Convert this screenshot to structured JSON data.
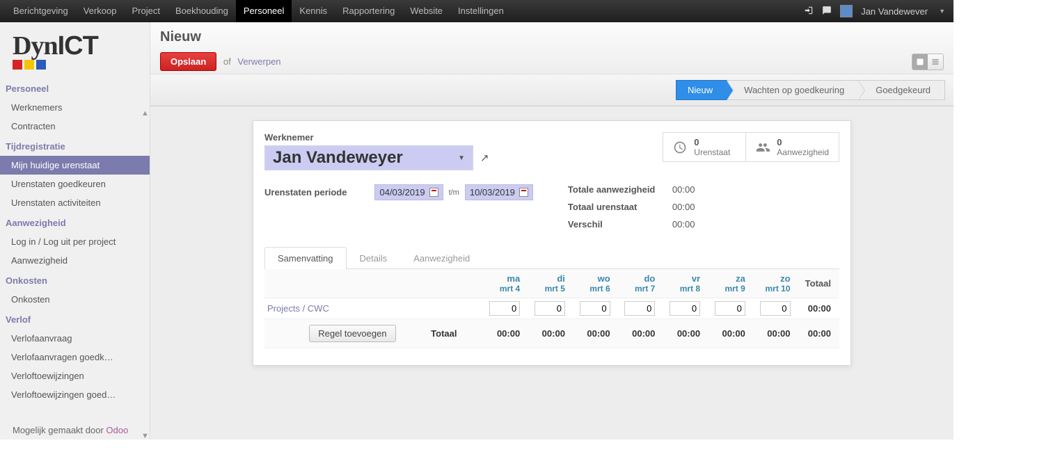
{
  "nav": {
    "items": [
      "Berichtgeving",
      "Verkoop",
      "Project",
      "Boekhouding",
      "Personeel",
      "Kennis",
      "Rapportering",
      "Website",
      "Instellingen"
    ],
    "active": 4
  },
  "user": {
    "name": "Jan Vandewever"
  },
  "logo": {
    "part1": "Dyn",
    "part2": "ICT"
  },
  "sidebar": {
    "groups": [
      {
        "title": "Personeel",
        "items": [
          "Werknemers",
          "Contracten"
        ],
        "active": -1
      },
      {
        "title": "Tijdregistratie",
        "items": [
          "Mijn huidige urenstaat",
          "Urenstaten goedkeuren",
          "Urenstaten activiteiten"
        ],
        "active": 0
      },
      {
        "title": "Aanwezigheid",
        "items": [
          "Log in / Log uit per project",
          "Aanwezigheid"
        ],
        "active": -1
      },
      {
        "title": "Onkosten",
        "items": [
          "Onkosten"
        ],
        "active": -1
      },
      {
        "title": "Verlof",
        "items": [
          "Verlofaanvraag",
          "Verlofaanvragen goedk…",
          "Verloftoewijzingen",
          "Verloftoewijzingen goed…"
        ],
        "active": -1
      }
    ],
    "powered_prefix": "Mogelijk gemaakt door ",
    "powered_link": "Odoo"
  },
  "header": {
    "title": "Nieuw",
    "save": "Opslaan",
    "or": "of",
    "discard": "Verwerpen"
  },
  "status": {
    "items": [
      "Nieuw",
      "Wachten op goedkeuring",
      "Goedgekeurd"
    ],
    "active": 0
  },
  "form": {
    "employee_label": "Werknemer",
    "employee": "Jan Vandeweyer",
    "period_label": "Urenstaten periode",
    "date_from": "04/03/2019",
    "date_to": "10/03/2019",
    "tm": "t/m",
    "stat1": {
      "num": "0",
      "label": "Urenstaat"
    },
    "stat2": {
      "num": "0",
      "label": "Aanwezigheid"
    },
    "totals": {
      "att_label": "Totale aanwezigheid",
      "att": "00:00",
      "ts_label": "Totaal urenstaat",
      "ts": "00:00",
      "diff_label": "Verschil",
      "diff": "00:00"
    }
  },
  "tabs": {
    "items": [
      "Samenvatting",
      "Details",
      "Aanwezigheid"
    ],
    "active": 0
  },
  "grid": {
    "days": [
      {
        "d": "ma",
        "s": "mrt 4"
      },
      {
        "d": "di",
        "s": "mrt 5"
      },
      {
        "d": "wo",
        "s": "mrt 6"
      },
      {
        "d": "do",
        "s": "mrt 7"
      },
      {
        "d": "vr",
        "s": "mrt 8"
      },
      {
        "d": "za",
        "s": "mrt 9"
      },
      {
        "d": "zo",
        "s": "mrt 10"
      }
    ],
    "total_col": "Totaal",
    "row": {
      "project": "Projects / CWC",
      "values": [
        "0",
        "0",
        "0",
        "0",
        "0",
        "0",
        "0"
      ],
      "total": "00:00"
    },
    "add_line": "Regel toevoegen",
    "foot_label": "Totaal",
    "foot": [
      "00:00",
      "00:00",
      "00:00",
      "00:00",
      "00:00",
      "00:00",
      "00:00"
    ],
    "foot_total": "00:00"
  }
}
